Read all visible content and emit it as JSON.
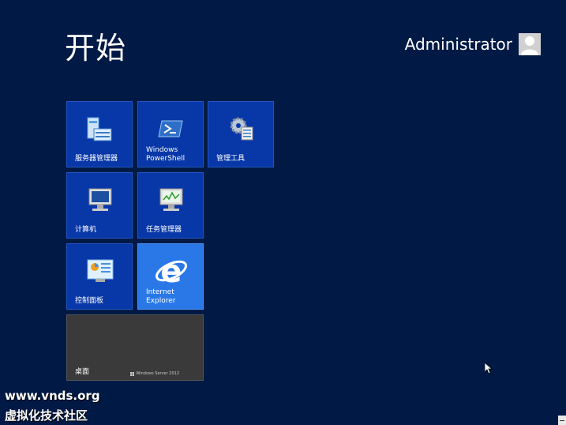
{
  "start": {
    "title": "开始"
  },
  "user": {
    "name": "Administrator",
    "icon": "user-avatar-icon"
  },
  "tiles": [
    {
      "label": "服务器管理器",
      "icon": "server-manager-icon"
    },
    {
      "label": "Windows\nPowerShell",
      "icon": "powershell-icon"
    },
    {
      "label": "管理工具",
      "icon": "admin-tools-icon"
    },
    {
      "label": "计算机",
      "icon": "computer-icon"
    },
    {
      "label": "任务管理器",
      "icon": "task-manager-icon"
    },
    {
      "label": "控制面板",
      "icon": "control-panel-icon"
    },
    {
      "label": "Internet\nExplorer",
      "icon": "internet-explorer-icon"
    },
    {
      "label": "桌面",
      "icon": "desktop-icon",
      "brand": "Windows Server 2012"
    }
  ],
  "watermark": {
    "line1": "www.vnds.org",
    "line2": "虚拟化技术社区"
  },
  "colors": {
    "background": "#011a45",
    "tile": "#0838a8",
    "tile_light": "#2a78e8",
    "desktop_tile": "#3a3a3a"
  }
}
